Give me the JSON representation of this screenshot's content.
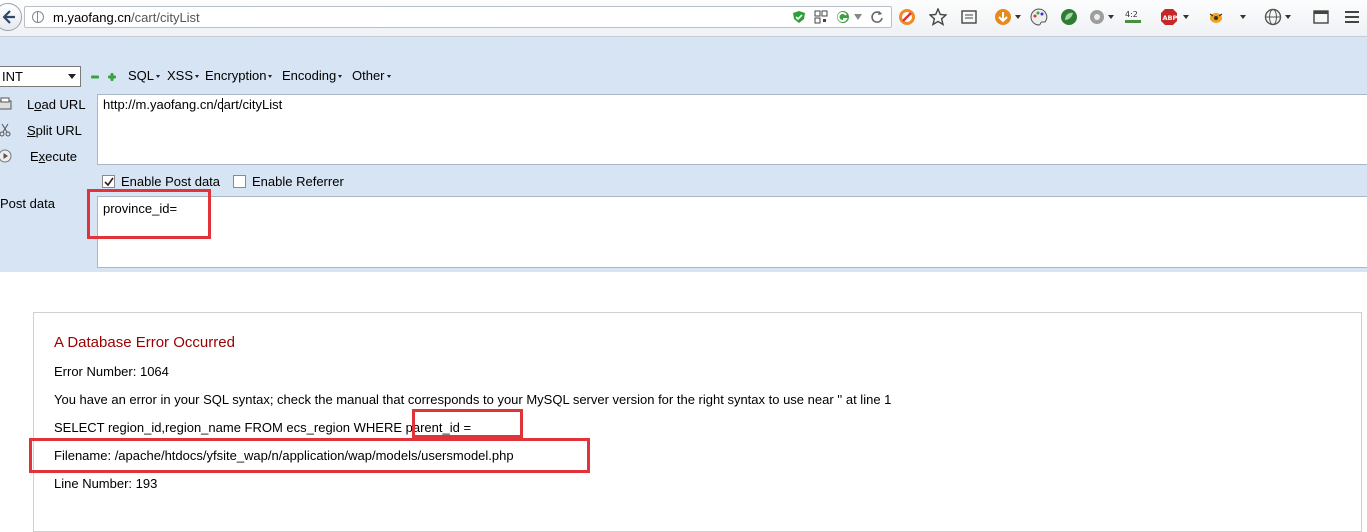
{
  "browser": {
    "url_domain": "m.yaofang.cn",
    "url_path": "/cart/cityList"
  },
  "hackbar": {
    "select_value": "INT",
    "menus": [
      "SQL",
      "XSS",
      "Encryption",
      "Encoding",
      "Other"
    ],
    "actions": {
      "load": "Load URL",
      "split": "Split URL",
      "execute": "Execute"
    },
    "url_value": "http://m.yaofang.cn/cart/cityList",
    "enable_post": {
      "label": "Enable Post data",
      "checked": true
    },
    "enable_referrer": {
      "label": "Enable Referrer",
      "checked": false
    },
    "post_label": "Post data",
    "post_value": "province_id="
  },
  "error": {
    "heading": "A Database Error Occurred",
    "error_number": "Error Number: 1064",
    "message": "You have an error in your SQL syntax; check the manual that corresponds to your MySQL server version for the right syntax to use near '' at line 1",
    "sql_prefix": "SELECT region_id,region_name FROM ecs_region WHERE ",
    "sql_suffix": "parent_id =",
    "filename": "Filename: /apache/htdocs/yfsite_wap/n/application/wap/models/usersmodel.php",
    "line_number": "Line Number: 193"
  },
  "colors": {
    "hackbar_bg": "#d6e4f3",
    "error_heading": "#990000",
    "highlight_box": "#e0343a"
  }
}
